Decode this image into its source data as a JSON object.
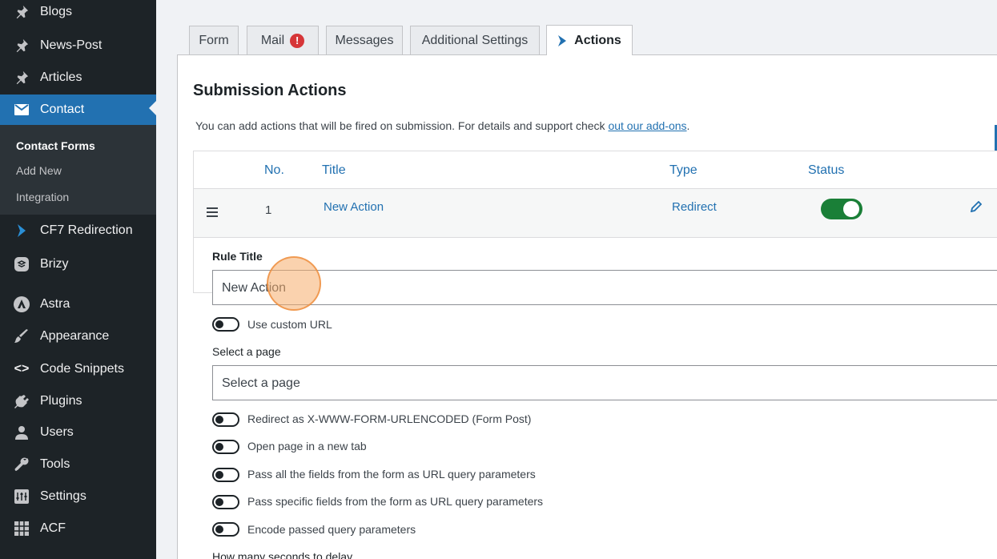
{
  "sidebar": {
    "items": [
      {
        "label": "Blogs",
        "icon": "pin-icon"
      },
      {
        "label": "News-Post",
        "icon": "pin-icon"
      },
      {
        "label": "Articles",
        "icon": "pin-icon"
      },
      {
        "label": "Contact",
        "icon": "mail-icon",
        "active": true
      },
      {
        "label": "CF7 Redirection",
        "icon": "chevron-right-icon"
      },
      {
        "label": "Brizy",
        "icon": "brizy-icon"
      },
      {
        "label": "Astra",
        "icon": "astra-icon"
      },
      {
        "label": "Appearance",
        "icon": "brush-icon"
      },
      {
        "label": "Code Snippets",
        "icon": "code-icon"
      },
      {
        "label": "Plugins",
        "icon": "plug-icon"
      },
      {
        "label": "Users",
        "icon": "user-icon"
      },
      {
        "label": "Tools",
        "icon": "wrench-icon"
      },
      {
        "label": "Settings",
        "icon": "settings-icon"
      },
      {
        "label": "ACF",
        "icon": "grid-icon"
      }
    ],
    "submenu": [
      {
        "label": "Contact Forms",
        "current": true
      },
      {
        "label": "Add New"
      },
      {
        "label": "Integration"
      }
    ]
  },
  "tabs": [
    {
      "label": "Form"
    },
    {
      "label": "Mail",
      "badge": "!"
    },
    {
      "label": "Messages"
    },
    {
      "label": "Additional Settings"
    },
    {
      "label": "Actions",
      "active": true
    }
  ],
  "main": {
    "title": "Submission Actions",
    "description": "You can add actions that will be fired on submission. For details and support check ",
    "description_link": "out our add-ons",
    "description_end": "."
  },
  "table": {
    "headers": {
      "no": "No.",
      "title": "Title",
      "type": "Type",
      "status": "Status"
    },
    "rows": [
      {
        "no": "1",
        "title": "New Action",
        "type": "Redirect",
        "status_on": true
      }
    ]
  },
  "editor": {
    "rule_title_label": "Rule Title",
    "rule_title_value": "New Action",
    "custom_url_label": "Use custom URL",
    "select_page_label": "Select a page",
    "select_page_value": "Select a page",
    "options": [
      "Redirect as X-WWW-FORM-URLENCODED (Form Post)",
      "Open page in a new tab",
      "Pass all the fields from the form as URL query parameters",
      "Pass specific fields from the form as URL query parameters",
      "Encode passed query parameters"
    ],
    "delay_label": "How many seconds to delay"
  },
  "colors": {
    "sidebar_bg": "#1d2327",
    "accent": "#2271b1",
    "toggle_on": "#1a7f37",
    "badge": "#d63638"
  }
}
